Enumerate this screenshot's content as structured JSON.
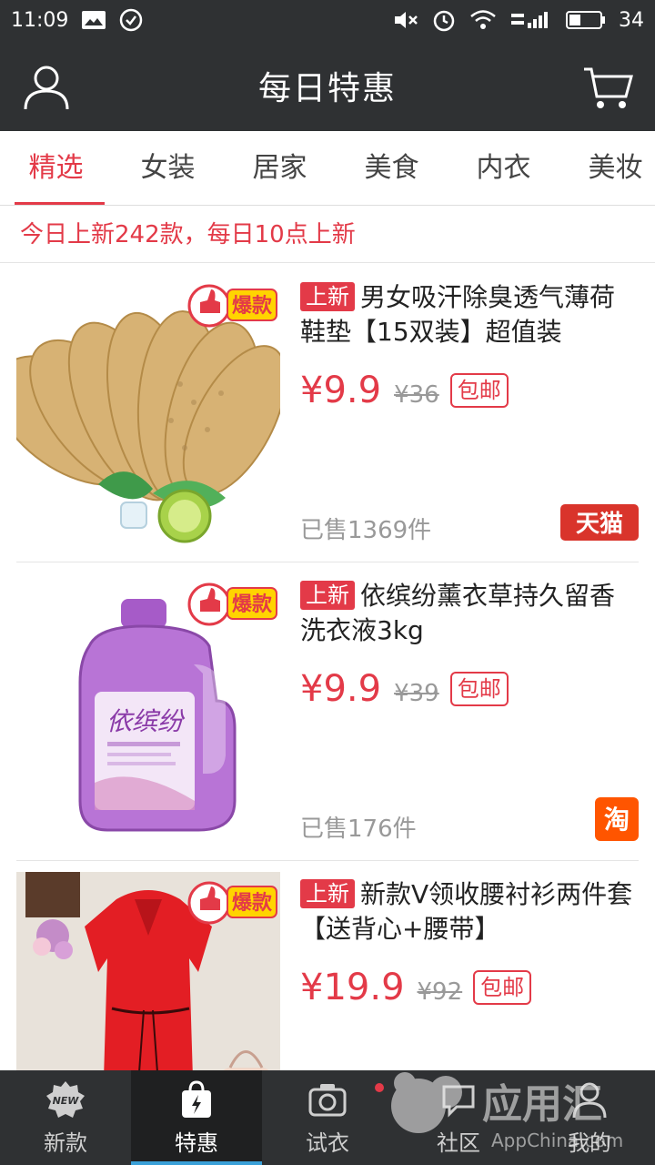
{
  "status": {
    "time": "11:09",
    "battery": "34"
  },
  "header": {
    "title": "每日特惠"
  },
  "tabs": [
    "精选",
    "女装",
    "居家",
    "美食",
    "内衣",
    "美妆"
  ],
  "notice": "今日上新242款，每日10点上新",
  "badges": {
    "hot": "爆款",
    "new": "上新",
    "ship": "包邮"
  },
  "items": [
    {
      "title": "男女吸汗除臭透气薄荷鞋垫【15双装】超值装",
      "price": "¥9.9",
      "orig": "¥36",
      "sold": "已售1369件",
      "platform": "天猫"
    },
    {
      "title": "依缤纷薰衣草持久留香洗衣液3kg",
      "price": "¥9.9",
      "orig": "¥39",
      "sold": "已售176件",
      "platform": "淘",
      "brand": "依缤纷"
    },
    {
      "title": "新款V领收腰衬衫两件套【送背心+腰带】",
      "price": "¥19.9",
      "orig": "¥92",
      "sold": "",
      "platform": ""
    }
  ],
  "nav": [
    {
      "label": "新款",
      "icon": "new-icon"
    },
    {
      "label": "特惠",
      "icon": "bag-icon"
    },
    {
      "label": "试衣",
      "icon": "camera-icon"
    },
    {
      "label": "社区",
      "icon": "community-icon"
    },
    {
      "label": "我的",
      "icon": "profile-icon"
    }
  ],
  "watermark": {
    "text": "应用汇",
    "sub": "AppChina.com"
  },
  "colors": {
    "accent": "#e33a48",
    "bar": "#2f3133",
    "tmall": "#d9342b",
    "taobao": "#ff5500"
  }
}
